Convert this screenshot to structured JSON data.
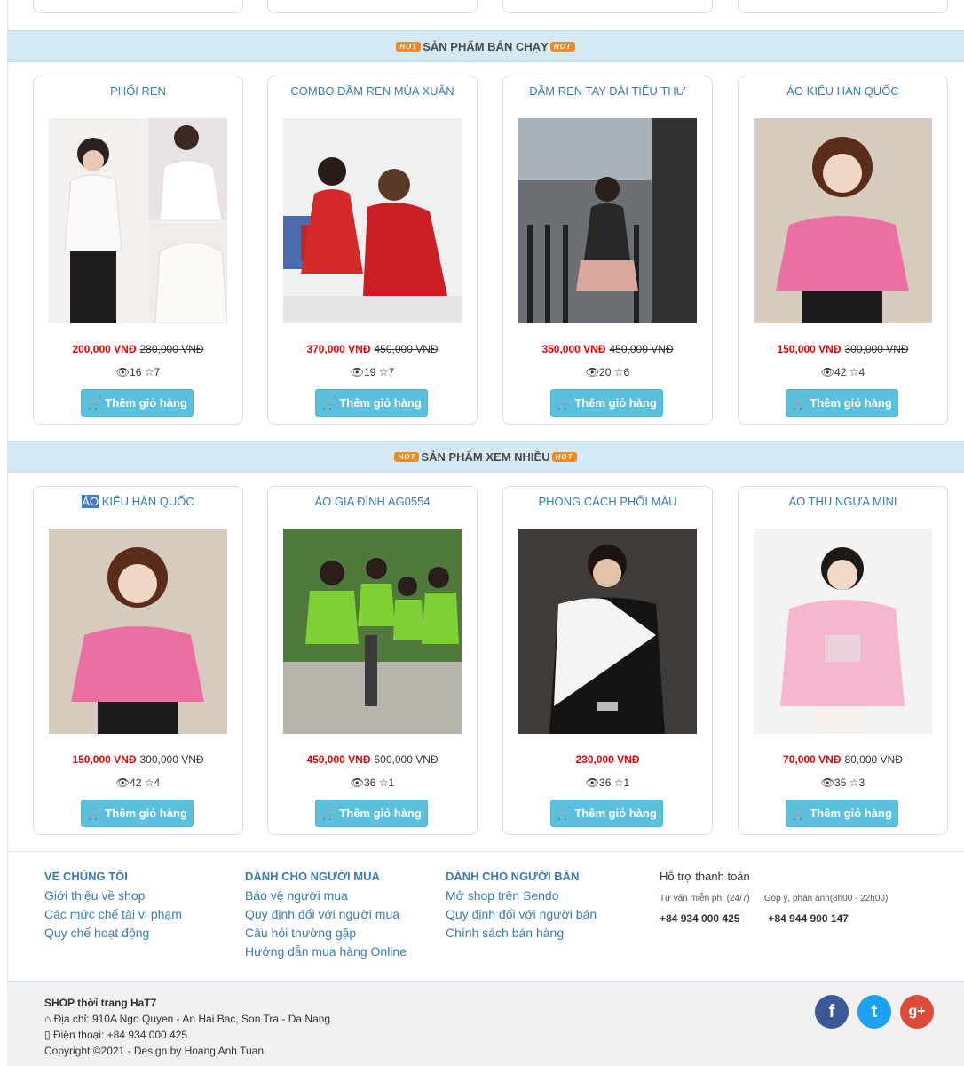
{
  "sections": {
    "best_selling": "SẢN PHẨM BÁN CHẠY",
    "most_viewed": "SẢN PHẨM XEM NHIỀU",
    "hot_badge": "HOT"
  },
  "best_selling": [
    {
      "name": "PHỐI REN",
      "price": "200,000 VNĐ",
      "old_price": "280,000 VNĐ",
      "views": "16",
      "stars": "7",
      "cart": "Thêm giỏ hàng"
    },
    {
      "name": "COMBO ĐẦM REN MÙA XUÂN",
      "price": "370,000 VNĐ",
      "old_price": "450,000 VNĐ",
      "views": "19",
      "stars": "7",
      "cart": "Thêm giỏ hàng"
    },
    {
      "name": "ĐẦM REN TAY DÀI TIỂU THƯ",
      "price": "350,000 VNĐ",
      "old_price": "450,000 VNĐ",
      "views": "20",
      "stars": "6",
      "cart": "Thêm giỏ hàng"
    },
    {
      "name": "ÁO KIỂU HÀN QUỐC",
      "price": "150,000 VNĐ",
      "old_price": "300,000 VNĐ",
      "views": "42",
      "stars": "4",
      "cart": "Thêm giỏ hàng"
    }
  ],
  "most_viewed": [
    {
      "name_hl": "ÁO",
      "name": " KIỂU HÀN QUỐC",
      "price": "150,000 VNĐ",
      "old_price": "300,000 VNĐ",
      "views": "42",
      "stars": "4",
      "cart": "Thêm giỏ hàng"
    },
    {
      "name": "ÁO GIA ĐÌNH AG0554",
      "price": "450,000 VNĐ",
      "old_price": "500,000 VNĐ",
      "views": "36",
      "stars": "1",
      "cart": "Thêm giỏ hàng"
    },
    {
      "name": "PHONG CÁCH PHỐI MÀU",
      "price": "230,000 VNĐ",
      "old_price": "",
      "views": "36",
      "stars": "1",
      "cart": "Thêm giỏ hàng"
    },
    {
      "name": "ÁO THU NGỰA MINI",
      "price": "70,000 VNĐ",
      "old_price": "80,000 VNĐ",
      "views": "35",
      "stars": "3",
      "cart": "Thêm giỏ hàng"
    }
  ],
  "footer": {
    "about": {
      "title": "VỀ CHÚNG TÔI",
      "links": [
        "Giới thiệu về shop",
        "Các mức chế tài vi phạm",
        "Quy chế hoạt động"
      ]
    },
    "buyers": {
      "title": "DÀNH CHO NGƯỜI MUA",
      "links": [
        "Bảo vệ người mua",
        "Quy định đối với người mua",
        "Câu hỏi thường gặp",
        "Hướng dẫn mua hàng Online"
      ]
    },
    "sellers": {
      "title": "DÀNH CHO NGƯỜI BÁN",
      "links": [
        "Mở shop trên Sendo",
        "Quy định đối với người bán",
        "Chính sách bán hàng"
      ]
    },
    "support": {
      "title": "Hỗ trợ thanh toán",
      "free_label": "Tư vấn miễn phí (24/7)",
      "feedback_label": "Góp ý, phản ánh(8h00 - 22h00)",
      "free_phone": "+84 934 000 425",
      "feedback_phone": "+84 944 900 147"
    }
  },
  "bottom": {
    "shop": "SHOP thời trang HaT7",
    "address": "Địa chỉ: 910A Ngo Quyen - An Hai Bac, Son Tra - Da Nang",
    "phone": "Điện thoại: +84 934 000 425",
    "copyright": "Copyright ©2021 - Design by Hoang Anh Tuan"
  },
  "colors": {
    "accent": "#3a7dac",
    "button": "#5bc0de",
    "price": "#e00000",
    "bar": "#d4e9f3",
    "facebook": "#3b5998",
    "twitter": "#1da1f2",
    "google": "#dd4b39"
  }
}
